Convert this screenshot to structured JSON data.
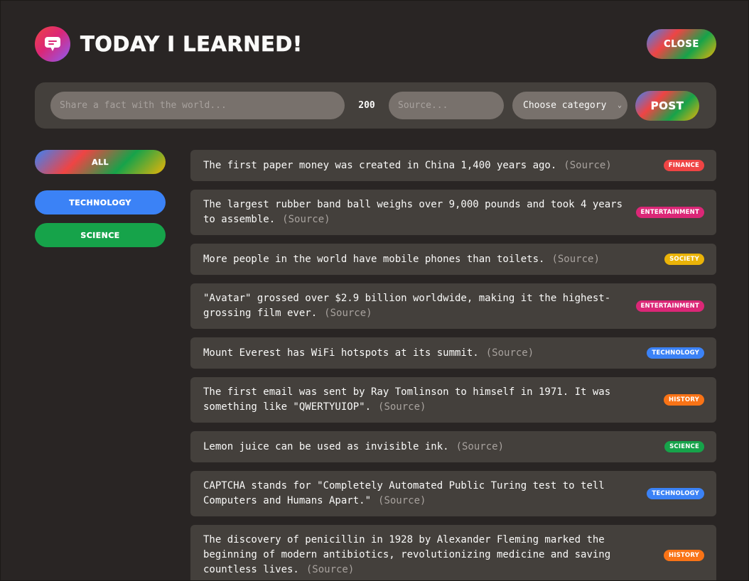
{
  "header": {
    "title": "Today I Learned!",
    "close_label": "Close"
  },
  "form": {
    "fact_placeholder": "Share a fact with the world...",
    "char_count": "200",
    "source_placeholder": "Source...",
    "category_value": "Choose category",
    "post_label": "Post"
  },
  "sidebar": {
    "all_label": "All",
    "items": [
      {
        "label": "Technology",
        "color": "#3b82f6"
      },
      {
        "label": "Science",
        "color": "#16a34a"
      }
    ]
  },
  "facts": [
    {
      "text": "The first paper money was created in China 1,400 years ago.",
      "source": "(Source)",
      "category": "Finance",
      "color": "#ef4444"
    },
    {
      "text": "The largest rubber band ball weighs over 9,000 pounds and took 4 years to assemble.",
      "source": "(Source)",
      "category": "Entertainment",
      "color": "#db2777"
    },
    {
      "text": "More people in the world have mobile phones than toilets.",
      "source": "(Source)",
      "category": "Society",
      "color": "#eab308"
    },
    {
      "text": "\"Avatar\" grossed over $2.9 billion worldwide, making it the highest-grossing film ever.",
      "source": "(Source)",
      "category": "Entertainment",
      "color": "#db2777"
    },
    {
      "text": "Mount Everest has WiFi hotspots at its summit.",
      "source": "(Source)",
      "category": "Technology",
      "color": "#3b82f6"
    },
    {
      "text": "The first email was sent by Ray Tomlinson to himself in 1971. It was something like \"QWERTYUIOP\".",
      "source": "(Source)",
      "category": "History",
      "color": "#f97316"
    },
    {
      "text": "Lemon juice can be used as invisible ink.",
      "source": "(Source)",
      "category": "Science",
      "color": "#16a34a"
    },
    {
      "text": "CAPTCHA stands for \"Completely Automated Public Turing test to tell Computers and Humans Apart.\"",
      "source": "(Source)",
      "category": "Technology",
      "color": "#3b82f6"
    },
    {
      "text": "The discovery of penicillin in 1928 by Alexander Fleming marked the beginning of modern antibiotics, revolutionizing medicine and saving countless lives.",
      "source": "(Source)",
      "category": "History",
      "color": "#f97316"
    }
  ]
}
